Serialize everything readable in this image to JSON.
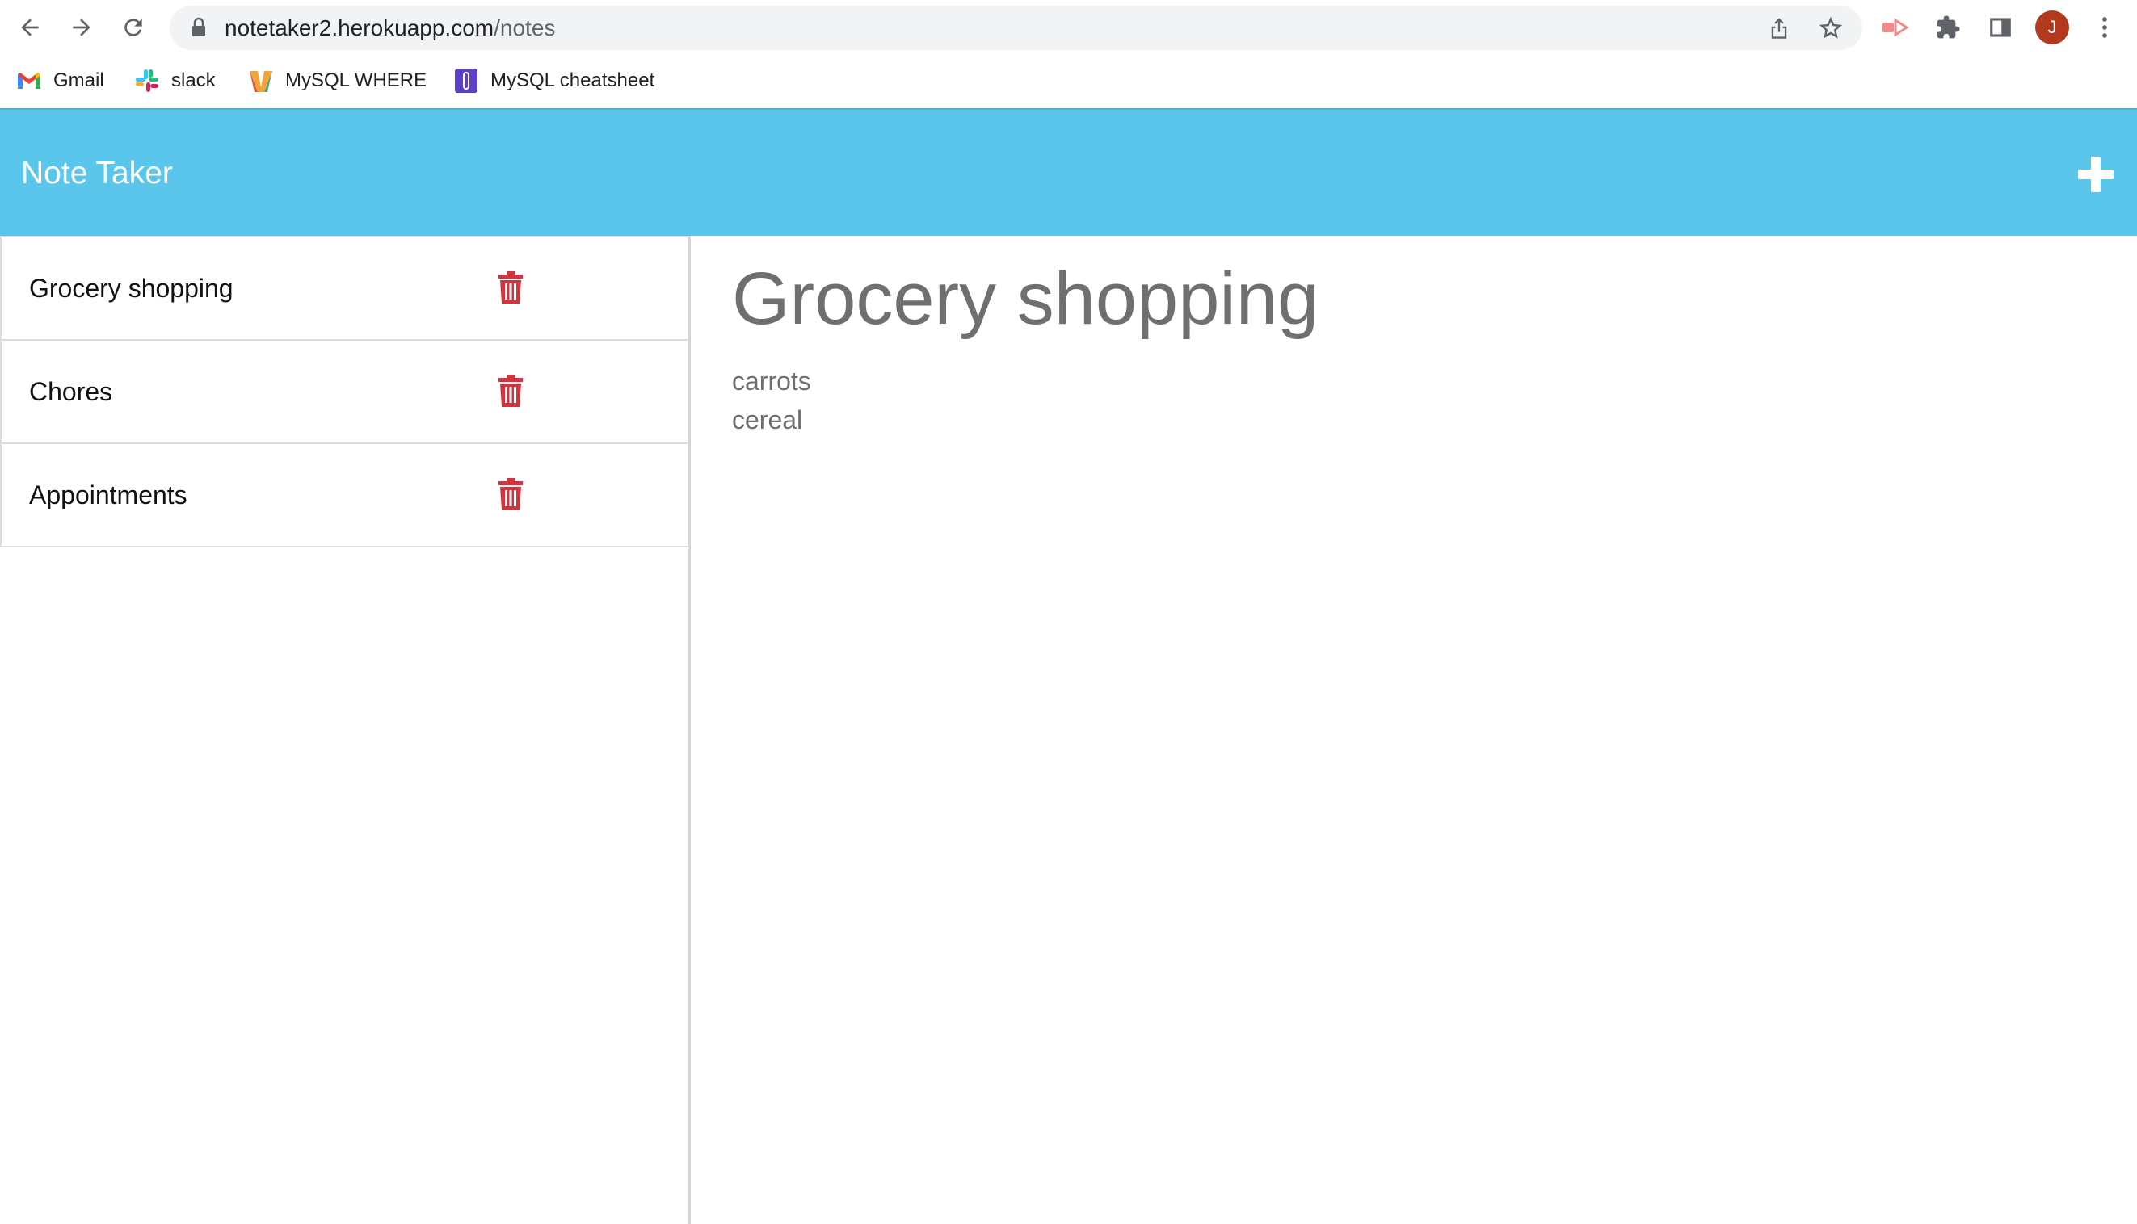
{
  "browser": {
    "url_host": "notetaker2.herokuapp.com",
    "url_path": "/notes",
    "profile_initial": "J",
    "bookmarks": [
      {
        "label": "Gmail",
        "icon": "gmail-icon"
      },
      {
        "label": "slack",
        "icon": "slack-icon"
      },
      {
        "label": "MySQL WHERE",
        "icon": "mysql-where-icon"
      },
      {
        "label": "MySQL cheatsheet",
        "icon": "mysql-cheatsheet-icon"
      }
    ]
  },
  "app": {
    "title": "Note Taker",
    "accent": "#5bc6ec"
  },
  "notes": [
    {
      "title": "Grocery shopping"
    },
    {
      "title": "Chores"
    },
    {
      "title": "Appointments"
    }
  ],
  "active_note": {
    "title": "Grocery shopping",
    "body": "carrots\ncereal"
  },
  "colors": {
    "delete": "#d3333f",
    "avatar": "#b3391d"
  }
}
